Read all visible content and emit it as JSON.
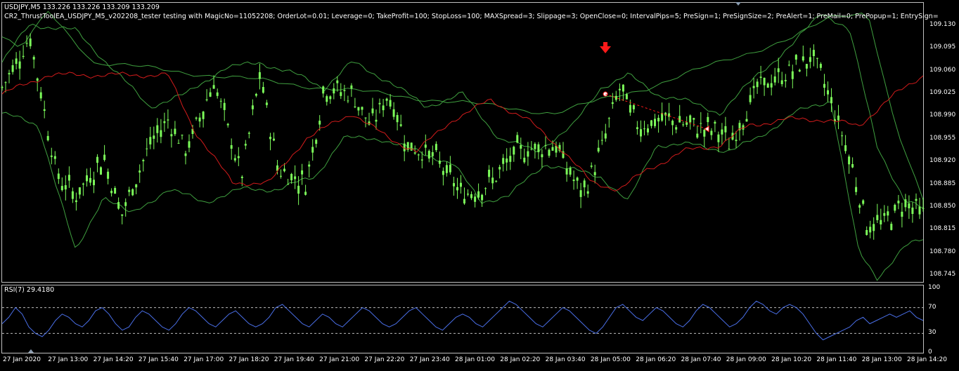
{
  "chart": {
    "symbol_line": "USDJPY,M5  133.226 133.226 133.209 133.209",
    "ea_line": "CR2_ThrustToolEA_USDJPY_M5_v202208_tester testing with MagicNo=11052208; OrderLot=0.01; Leverage=0; TakeProfit=100; StopLoss=100; MAXSpread=3; Slippage=3; OpenClose=0; IntervalPips=5; PreSign=1; PreSignSize=2; PreAlert=1; PreMail=0; PrePopup=1; EntrySign=",
    "rsi_label": "RSI(7) 29.4180",
    "colors": {
      "background": "#000000",
      "candle": "#7CFC5A",
      "bollinger": "#3f9f3f",
      "moving_average": "#d21b1b",
      "rsi_line": "#4a6fe8",
      "signal_arrow": "#ff1a1a",
      "text": "#ffffff",
      "border": "#c0c0c0"
    },
    "icons": {
      "signal": "red-down-arrow-icon",
      "scroll_marker": "triangle-marker-icon"
    }
  },
  "chart_data": [
    {
      "type": "candlestick",
      "title": "USDJPY,M5",
      "ylim": [
        108.735,
        109.145
      ],
      "y_ticks": [
        "109.130",
        "109.095",
        "109.060",
        "109.025",
        "108.990",
        "108.955",
        "108.920",
        "108.885",
        "108.850",
        "108.815",
        "108.780",
        "108.745"
      ],
      "x_ticks": [
        "27 Jan 2020",
        "27 Jan 13:00",
        "27 Jan 14:20",
        "27 Jan 15:40",
        "27 Jan 17:00",
        "27 Jan 18:20",
        "27 Jan 19:40",
        "27 Jan 21:00",
        "27 Jan 22:20",
        "27 Jan 23:40",
        "28 Jan 01:00",
        "28 Jan 02:20",
        "28 Jan 03:40",
        "28 Jan 05:00",
        "28 Jan 06:20",
        "28 Jan 07:40",
        "28 Jan 09:00",
        "28 Jan 10:20",
        "28 Jan 11:40",
        "28 Jan 13:00",
        "28 Jan 14:20"
      ],
      "close_path": [
        {
          "t": 0.0,
          "p": 109.04
        },
        {
          "t": 0.03,
          "p": 109.12
        },
        {
          "t": 0.06,
          "p": 108.9
        },
        {
          "t": 0.08,
          "p": 108.87
        },
        {
          "t": 0.11,
          "p": 108.93
        },
        {
          "t": 0.13,
          "p": 108.84
        },
        {
          "t": 0.16,
          "p": 108.95
        },
        {
          "t": 0.18,
          "p": 108.99
        },
        {
          "t": 0.2,
          "p": 108.94
        },
        {
          "t": 0.23,
          "p": 109.05
        },
        {
          "t": 0.26,
          "p": 108.9
        },
        {
          "t": 0.28,
          "p": 109.06
        },
        {
          "t": 0.3,
          "p": 108.91
        },
        {
          "t": 0.33,
          "p": 108.89
        },
        {
          "t": 0.35,
          "p": 109.04
        },
        {
          "t": 0.38,
          "p": 109.03
        },
        {
          "t": 0.4,
          "p": 108.98
        },
        {
          "t": 0.42,
          "p": 109.03
        },
        {
          "t": 0.44,
          "p": 108.95
        },
        {
          "t": 0.47,
          "p": 108.93
        },
        {
          "t": 0.5,
          "p": 108.87
        },
        {
          "t": 0.53,
          "p": 108.89
        },
        {
          "t": 0.56,
          "p": 108.94
        },
        {
          "t": 0.6,
          "p": 108.95
        },
        {
          "t": 0.63,
          "p": 108.87
        },
        {
          "t": 0.65,
          "p": 108.94
        },
        {
          "t": 0.67,
          "p": 109.04
        },
        {
          "t": 0.69,
          "p": 108.98
        },
        {
          "t": 0.72,
          "p": 108.99
        },
        {
          "t": 0.75,
          "p": 108.98
        },
        {
          "t": 0.78,
          "p": 108.97
        },
        {
          "t": 0.79,
          "p": 108.95
        },
        {
          "t": 0.82,
          "p": 109.04
        },
        {
          "t": 0.85,
          "p": 109.06
        },
        {
          "t": 0.88,
          "p": 109.09
        },
        {
          "t": 0.9,
          "p": 109.02
        },
        {
          "t": 0.92,
          "p": 108.93
        },
        {
          "t": 0.94,
          "p": 108.82
        },
        {
          "t": 0.96,
          "p": 108.83
        },
        {
          "t": 0.98,
          "p": 108.86
        },
        {
          "t": 1.0,
          "p": 108.84
        }
      ],
      "moving_average": [
        {
          "t": 0.0,
          "p": 109.03
        },
        {
          "t": 0.05,
          "p": 109.06
        },
        {
          "t": 0.12,
          "p": 109.06
        },
        {
          "t": 0.18,
          "p": 109.06
        },
        {
          "t": 0.21,
          "p": 108.97
        },
        {
          "t": 0.25,
          "p": 108.89
        },
        {
          "t": 0.29,
          "p": 108.89
        },
        {
          "t": 0.33,
          "p": 108.96
        },
        {
          "t": 0.38,
          "p": 109.0
        },
        {
          "t": 0.42,
          "p": 108.96
        },
        {
          "t": 0.45,
          "p": 108.94
        },
        {
          "t": 0.49,
          "p": 108.99
        },
        {
          "t": 0.53,
          "p": 109.02
        },
        {
          "t": 0.57,
          "p": 108.99
        },
        {
          "t": 0.61,
          "p": 108.94
        },
        {
          "t": 0.64,
          "p": 108.89
        },
        {
          "t": 0.67,
          "p": 108.88
        },
        {
          "t": 0.7,
          "p": 108.91
        },
        {
          "t": 0.74,
          "p": 108.94
        },
        {
          "t": 0.78,
          "p": 108.95
        },
        {
          "t": 0.81,
          "p": 108.98
        },
        {
          "t": 0.85,
          "p": 108.99
        },
        {
          "t": 0.89,
          "p": 108.99
        },
        {
          "t": 0.93,
          "p": 108.98
        },
        {
          "t": 0.97,
          "p": 109.03
        },
        {
          "t": 1.0,
          "p": 109.06
        }
      ],
      "bollinger_upper": [
        {
          "t": 0.0,
          "p": 109.08
        },
        {
          "t": 0.03,
          "p": 109.14
        },
        {
          "t": 0.08,
          "p": 109.13
        },
        {
          "t": 0.12,
          "p": 109.07
        },
        {
          "t": 0.16,
          "p": 109.01
        },
        {
          "t": 0.2,
          "p": 109.03
        },
        {
          "t": 0.24,
          "p": 109.07
        },
        {
          "t": 0.28,
          "p": 109.08
        },
        {
          "t": 0.32,
          "p": 109.06
        },
        {
          "t": 0.35,
          "p": 109.04
        },
        {
          "t": 0.38,
          "p": 109.08
        },
        {
          "t": 0.42,
          "p": 109.05
        },
        {
          "t": 0.46,
          "p": 109.01
        },
        {
          "t": 0.5,
          "p": 109.03
        },
        {
          "t": 0.54,
          "p": 108.96
        },
        {
          "t": 0.58,
          "p": 108.94
        },
        {
          "t": 0.62,
          "p": 108.98
        },
        {
          "t": 0.65,
          "p": 109.04
        },
        {
          "t": 0.68,
          "p": 109.06
        },
        {
          "t": 0.71,
          "p": 109.03
        },
        {
          "t": 0.74,
          "p": 109.02
        },
        {
          "t": 0.78,
          "p": 109.0
        },
        {
          "t": 0.82,
          "p": 109.06
        },
        {
          "t": 0.86,
          "p": 109.11
        },
        {
          "t": 0.89,
          "p": 109.16
        },
        {
          "t": 0.92,
          "p": 109.13
        },
        {
          "t": 0.95,
          "p": 108.95
        },
        {
          "t": 0.98,
          "p": 108.86
        },
        {
          "t": 1.0,
          "p": 108.85
        }
      ],
      "bollinger_lower": [
        {
          "t": 0.0,
          "p": 109.0
        },
        {
          "t": 0.04,
          "p": 108.98
        },
        {
          "t": 0.08,
          "p": 108.78
        },
        {
          "t": 0.11,
          "p": 108.87
        },
        {
          "t": 0.14,
          "p": 108.84
        },
        {
          "t": 0.18,
          "p": 108.88
        },
        {
          "t": 0.22,
          "p": 108.86
        },
        {
          "t": 0.26,
          "p": 108.88
        },
        {
          "t": 0.3,
          "p": 108.88
        },
        {
          "t": 0.34,
          "p": 108.9
        },
        {
          "t": 0.37,
          "p": 108.96
        },
        {
          "t": 0.41,
          "p": 108.96
        },
        {
          "t": 0.45,
          "p": 108.94
        },
        {
          "t": 0.49,
          "p": 108.92
        },
        {
          "t": 0.52,
          "p": 108.86
        },
        {
          "t": 0.55,
          "p": 108.87
        },
        {
          "t": 0.59,
          "p": 108.92
        },
        {
          "t": 0.62,
          "p": 108.91
        },
        {
          "t": 0.65,
          "p": 108.9
        },
        {
          "t": 0.68,
          "p": 108.86
        },
        {
          "t": 0.71,
          "p": 108.95
        },
        {
          "t": 0.75,
          "p": 108.95
        },
        {
          "t": 0.79,
          "p": 108.94
        },
        {
          "t": 0.82,
          "p": 108.96
        },
        {
          "t": 0.86,
          "p": 109.0
        },
        {
          "t": 0.9,
          "p": 109.02
        },
        {
          "t": 0.93,
          "p": 108.78
        },
        {
          "t": 0.95,
          "p": 108.74
        },
        {
          "t": 0.98,
          "p": 108.79
        },
        {
          "t": 1.0,
          "p": 108.8
        }
      ],
      "bollinger_outer": [
        {
          "t": 0.0,
          "p": 109.12
        },
        {
          "t": 0.02,
          "p": 109.1
        },
        {
          "t": 0.05,
          "p": 109.16
        },
        {
          "t": 0.1,
          "p": 109.08
        },
        {
          "t": 0.6,
          "p": 109.0
        },
        {
          "t": 0.7,
          "p": 109.04
        },
        {
          "t": 0.86,
          "p": 109.12
        },
        {
          "t": 0.9,
          "p": 109.15
        },
        {
          "t": 0.94,
          "p": 109.16
        },
        {
          "t": 0.97,
          "p": 108.98
        },
        {
          "t": 1.0,
          "p": 108.86
        }
      ],
      "signal": {
        "t": 0.655,
        "p": 109.03,
        "label": "sell-arrow"
      }
    },
    {
      "type": "line",
      "title": "RSI(7) 29.4180",
      "ylim": [
        0,
        100
      ],
      "y_ticks": [
        "100",
        "70",
        "30",
        "0"
      ],
      "levels": [
        70,
        30
      ],
      "series": [
        {
          "values": [
            45,
            55,
            70,
            60,
            40,
            30,
            25,
            35,
            50,
            60,
            55,
            45,
            40,
            50,
            65,
            70,
            60,
            45,
            35,
            40,
            55,
            65,
            60,
            50,
            40,
            35,
            45,
            60,
            70,
            65,
            55,
            45,
            40,
            50,
            60,
            65,
            55,
            45,
            40,
            45,
            55,
            70,
            75,
            65,
            55,
            45,
            40,
            50,
            60,
            55,
            45,
            40,
            50,
            60,
            70,
            65,
            55,
            45,
            40,
            45,
            55,
            65,
            70,
            60,
            50,
            40,
            35,
            45,
            55,
            60,
            55,
            45,
            40,
            50,
            60,
            70,
            80,
            75,
            65,
            55,
            45,
            40,
            50,
            60,
            70,
            65,
            55,
            45,
            35,
            30,
            40,
            55,
            70,
            75,
            65,
            55,
            50,
            60,
            70,
            65,
            55,
            45,
            40,
            50,
            65,
            75,
            70,
            60,
            50,
            40,
            45,
            55,
            70,
            80,
            75,
            65,
            60,
            70,
            75,
            70,
            60,
            45,
            30,
            20,
            25,
            30,
            35,
            40,
            50,
            55,
            45,
            50,
            55,
            60,
            55,
            60,
            65,
            55,
            50
          ]
        }
      ]
    }
  ]
}
